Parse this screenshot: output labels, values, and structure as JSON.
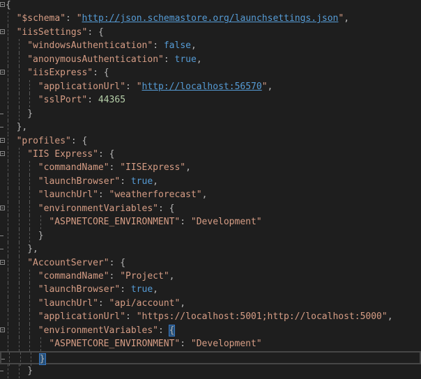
{
  "editor": {
    "language": "json",
    "current_line": 26,
    "colors": {
      "background": "#1e1e1e",
      "string": "#d69d85",
      "keyword": "#569cd6",
      "number": "#b5cea8",
      "punctuation": "#b4b4b4"
    },
    "lines": [
      {
        "i": 0,
        "fold": "open",
        "tokens": [
          {
            "c": "br",
            "t": "{"
          }
        ]
      },
      {
        "i": 1,
        "tokens": [
          {
            "c": "k",
            "t": "\"$schema\""
          },
          {
            "c": "p",
            "t": ": "
          },
          {
            "c": "s",
            "t": "\""
          },
          {
            "c": "u",
            "t": "http://json.schemastore.org/launchsettings.json"
          },
          {
            "c": "s",
            "t": "\""
          },
          {
            "c": "p",
            "t": ","
          }
        ]
      },
      {
        "i": 1,
        "fold": "open",
        "tokens": [
          {
            "c": "k",
            "t": "\"iisSettings\""
          },
          {
            "c": "p",
            "t": ": "
          },
          {
            "c": "br",
            "t": "{"
          }
        ]
      },
      {
        "i": 2,
        "tokens": [
          {
            "c": "k",
            "t": "\"windowsAuthentication\""
          },
          {
            "c": "p",
            "t": ": "
          },
          {
            "c": "b",
            "t": "false"
          },
          {
            "c": "p",
            "t": ","
          }
        ]
      },
      {
        "i": 2,
        "tokens": [
          {
            "c": "k",
            "t": "\"anonymousAuthentication\""
          },
          {
            "c": "p",
            "t": ": "
          },
          {
            "c": "b",
            "t": "true"
          },
          {
            "c": "p",
            "t": ","
          }
        ]
      },
      {
        "i": 2,
        "fold": "open",
        "tokens": [
          {
            "c": "k",
            "t": "\"iisExpress\""
          },
          {
            "c": "p",
            "t": ": "
          },
          {
            "c": "br",
            "t": "{"
          }
        ]
      },
      {
        "i": 3,
        "tokens": [
          {
            "c": "k",
            "t": "\"applicationUrl\""
          },
          {
            "c": "p",
            "t": ": "
          },
          {
            "c": "s",
            "t": "\""
          },
          {
            "c": "u",
            "t": "http://localhost:56570"
          },
          {
            "c": "s",
            "t": "\""
          },
          {
            "c": "p",
            "t": ","
          }
        ]
      },
      {
        "i": 3,
        "tokens": [
          {
            "c": "k",
            "t": "\"sslPort\""
          },
          {
            "c": "p",
            "t": ": "
          },
          {
            "c": "n",
            "t": "44365"
          }
        ]
      },
      {
        "i": 2,
        "fold": "end",
        "tokens": [
          {
            "c": "br",
            "t": "}"
          }
        ]
      },
      {
        "i": 1,
        "fold": "end",
        "tokens": [
          {
            "c": "br",
            "t": "}"
          },
          {
            "c": "p",
            "t": ","
          }
        ]
      },
      {
        "i": 1,
        "fold": "open",
        "tokens": [
          {
            "c": "k",
            "t": "\"profiles\""
          },
          {
            "c": "p",
            "t": ": "
          },
          {
            "c": "br",
            "t": "{"
          }
        ]
      },
      {
        "i": 2,
        "fold": "open",
        "tokens": [
          {
            "c": "k",
            "t": "\"IIS Express\""
          },
          {
            "c": "p",
            "t": ": "
          },
          {
            "c": "br",
            "t": "{"
          }
        ]
      },
      {
        "i": 3,
        "tokens": [
          {
            "c": "k",
            "t": "\"commandName\""
          },
          {
            "c": "p",
            "t": ": "
          },
          {
            "c": "s",
            "t": "\"IISExpress\""
          },
          {
            "c": "p",
            "t": ","
          }
        ]
      },
      {
        "i": 3,
        "tokens": [
          {
            "c": "k",
            "t": "\"launchBrowser\""
          },
          {
            "c": "p",
            "t": ": "
          },
          {
            "c": "b",
            "t": "true"
          },
          {
            "c": "p",
            "t": ","
          }
        ]
      },
      {
        "i": 3,
        "tokens": [
          {
            "c": "k",
            "t": "\"launchUrl\""
          },
          {
            "c": "p",
            "t": ": "
          },
          {
            "c": "s",
            "t": "\"weatherforecast\""
          },
          {
            "c": "p",
            "t": ","
          }
        ]
      },
      {
        "i": 3,
        "fold": "open",
        "tokens": [
          {
            "c": "k",
            "t": "\"environmentVariables\""
          },
          {
            "c": "p",
            "t": ": "
          },
          {
            "c": "br",
            "t": "{"
          }
        ]
      },
      {
        "i": 4,
        "tokens": [
          {
            "c": "k",
            "t": "\"ASPNETCORE_ENVIRONMENT\""
          },
          {
            "c": "p",
            "t": ": "
          },
          {
            "c": "s",
            "t": "\"Development\""
          }
        ]
      },
      {
        "i": 3,
        "fold": "end",
        "tokens": [
          {
            "c": "br",
            "t": "}"
          }
        ]
      },
      {
        "i": 2,
        "fold": "end",
        "tokens": [
          {
            "c": "br",
            "t": "}"
          },
          {
            "c": "p",
            "t": ","
          }
        ]
      },
      {
        "i": 2,
        "fold": "open",
        "tokens": [
          {
            "c": "k",
            "t": "\"AccountServer\""
          },
          {
            "c": "p",
            "t": ": "
          },
          {
            "c": "br",
            "t": "{"
          }
        ]
      },
      {
        "i": 3,
        "tokens": [
          {
            "c": "k",
            "t": "\"commandName\""
          },
          {
            "c": "p",
            "t": ": "
          },
          {
            "c": "s",
            "t": "\"Project\""
          },
          {
            "c": "p",
            "t": ","
          }
        ]
      },
      {
        "i": 3,
        "tokens": [
          {
            "c": "k",
            "t": "\"launchBrowser\""
          },
          {
            "c": "p",
            "t": ": "
          },
          {
            "c": "b",
            "t": "true"
          },
          {
            "c": "p",
            "t": ","
          }
        ]
      },
      {
        "i": 3,
        "tokens": [
          {
            "c": "k",
            "t": "\"launchUrl\""
          },
          {
            "c": "p",
            "t": ": "
          },
          {
            "c": "s",
            "t": "\"api/account\""
          },
          {
            "c": "p",
            "t": ","
          }
        ]
      },
      {
        "i": 3,
        "tokens": [
          {
            "c": "k",
            "t": "\"applicationUrl\""
          },
          {
            "c": "p",
            "t": ": "
          },
          {
            "c": "s",
            "t": "\"https://localhost:5001;http://localhost:5000\""
          },
          {
            "c": "p",
            "t": ","
          }
        ]
      },
      {
        "i": 3,
        "fold": "open",
        "tokens": [
          {
            "c": "k",
            "t": "\"environmentVariables\""
          },
          {
            "c": "p",
            "t": ": "
          },
          {
            "c": "br hl",
            "t": "{"
          }
        ]
      },
      {
        "i": 4,
        "tokens": [
          {
            "c": "k",
            "t": "\"ASPNETCORE_ENVIRONMENT\""
          },
          {
            "c": "p",
            "t": ": "
          },
          {
            "c": "s",
            "t": "\"Development\""
          }
        ]
      },
      {
        "i": 3,
        "fold": "end",
        "cursor": true,
        "tokens": [
          {
            "c": "br hl",
            "t": "}"
          }
        ]
      },
      {
        "i": 2,
        "fold": "end",
        "tokens": [
          {
            "c": "br",
            "t": "}"
          }
        ]
      }
    ]
  }
}
